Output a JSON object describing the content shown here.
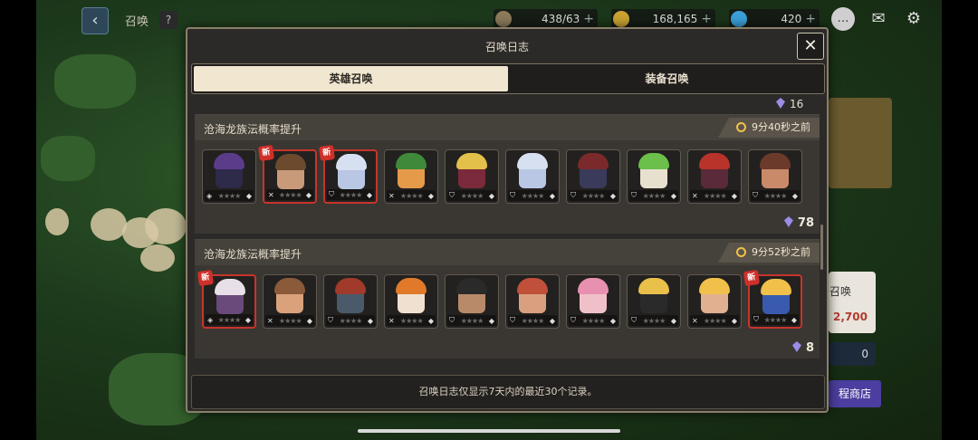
{
  "header": {
    "title": "召唤",
    "help": "?"
  },
  "resources": [
    {
      "name": "stamina",
      "value": "438/63",
      "color": "#8c7a5a"
    },
    {
      "name": "gold",
      "value": "168,165",
      "color": "#c9a232"
    },
    {
      "name": "gems",
      "value": "420",
      "color": "#3aa0d8"
    }
  ],
  "side": {
    "summon_label": "召唤",
    "price": "2,700",
    "count": "0",
    "shop_label": "程商店"
  },
  "modal": {
    "title": "召唤日志",
    "close": "✕",
    "tabs": [
      {
        "label": "英雄召唤",
        "active": true
      },
      {
        "label": "装备召唤",
        "active": false
      }
    ],
    "top_partial_cost": "16",
    "records": [
      {
        "title": "沧海龙族沄概率提升",
        "time": "9分40秒之前",
        "cost": "78",
        "heroes": [
          {
            "name": "hero-purple-hair",
            "new": false,
            "hair": "#5b3c8a",
            "skin": "#2e2a4a"
          },
          {
            "name": "hero-flower-girl",
            "new": true,
            "hair": "#6b4a2e",
            "skin": "#c99a7a"
          },
          {
            "name": "hero-white-dragon",
            "new": true,
            "hair": "#d6e0f0",
            "skin": "#b9c7e4"
          },
          {
            "name": "hero-green-hat",
            "new": false,
            "hair": "#3e8a3a",
            "skin": "#e59a4a"
          },
          {
            "name": "hero-horned-blonde",
            "new": false,
            "hair": "#e3c04a",
            "skin": "#7a2a3a"
          },
          {
            "name": "hero-white-dragon-2",
            "new": false,
            "hair": "#d6e0f0",
            "skin": "#b9c7e4"
          },
          {
            "name": "hero-pirate",
            "new": false,
            "hair": "#7a2a2a",
            "skin": "#3a3a5a"
          },
          {
            "name": "hero-green-flower",
            "new": false,
            "hair": "#6bbf4a",
            "skin": "#e8e0cf"
          },
          {
            "name": "hero-red-ninja",
            "new": false,
            "hair": "#b8332a",
            "skin": "#5a2a3a"
          },
          {
            "name": "hero-brown-girl",
            "new": false,
            "hair": "#6b3a2a",
            "skin": "#c98a6a"
          }
        ]
      },
      {
        "title": "沧海龙族沄概率提升",
        "time": "9分52秒之前",
        "cost": "8",
        "heroes": [
          {
            "name": "hero-white-elf",
            "new": true,
            "hair": "#e8e0e8",
            "skin": "#6a4a7a"
          },
          {
            "name": "hero-spiky-brown",
            "new": false,
            "hair": "#8a5a3a",
            "skin": "#d9a27a"
          },
          {
            "name": "hero-armored-red",
            "new": false,
            "hair": "#a03a2a",
            "skin": "#4a5a6a"
          },
          {
            "name": "hero-fox-girl",
            "new": false,
            "hair": "#e07a2a",
            "skin": "#f0e0d0"
          },
          {
            "name": "hero-dark-hair",
            "new": false,
            "hair": "#2a2a2a",
            "skin": "#b98a6a"
          },
          {
            "name": "hero-red-hair",
            "new": false,
            "hair": "#c0503a",
            "skin": "#d9a080"
          },
          {
            "name": "hero-pink-twin",
            "new": false,
            "hair": "#e890b0",
            "skin": "#f0c0c8"
          },
          {
            "name": "hero-blonde-spikes",
            "new": false,
            "hair": "#e8c04a",
            "skin": "#2a2a2a"
          },
          {
            "name": "hero-blonde-boy",
            "new": false,
            "hair": "#f0c04a",
            "skin": "#e0b090"
          },
          {
            "name": "hero-blonde-girl",
            "new": true,
            "hair": "#f0c04a",
            "skin": "#3a5ab0"
          }
        ]
      }
    ],
    "footer": "召唤日志仅显示7天内的最近30个记录。"
  }
}
